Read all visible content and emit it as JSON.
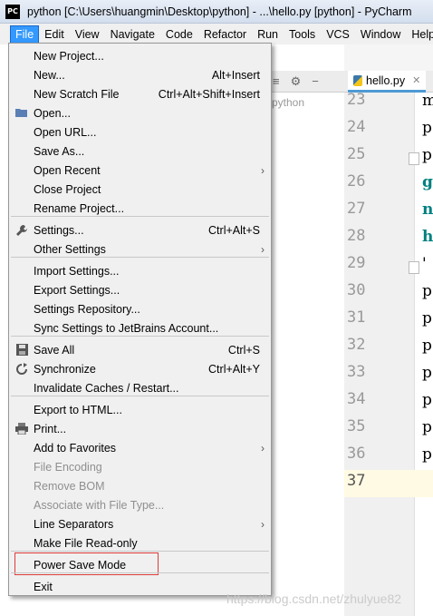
{
  "window": {
    "app_icon": "PC",
    "title": "python [C:\\Users\\huangmin\\Desktop\\python] - ...\\hello.py [python] - PyCharm"
  },
  "menubar": {
    "items": [
      "File",
      "Edit",
      "View",
      "Navigate",
      "Code",
      "Refactor",
      "Run",
      "Tools",
      "VCS",
      "Window",
      "Help"
    ]
  },
  "project_pane": {
    "label": "python",
    "toolbar_icons": [
      "collapse-icon",
      "gear-icon",
      "hide-icon"
    ]
  },
  "editor": {
    "tab_label": "hello.py",
    "line_numbers": [
      "23",
      "24",
      "25",
      "26",
      "27",
      "28",
      "29",
      "30",
      "31",
      "32",
      "33",
      "34",
      "35",
      "36",
      "37"
    ],
    "visible_code_chars": [
      "m",
      "p",
      "p",
      "g",
      "n",
      "h",
      "'",
      "p",
      "p",
      "p",
      "p",
      "p",
      "p",
      "p",
      ""
    ]
  },
  "file_menu": {
    "items": [
      {
        "label": "New Project...",
        "shortcut": "",
        "icon": "",
        "submenu": false,
        "disabled": false
      },
      {
        "label": "New...",
        "shortcut": "Alt+Insert",
        "icon": "",
        "submenu": false,
        "disabled": false
      },
      {
        "label": "New Scratch File",
        "shortcut": "Ctrl+Alt+Shift+Insert",
        "icon": "",
        "submenu": false,
        "disabled": false
      },
      {
        "label": "Open...",
        "shortcut": "",
        "icon": "folder-icon",
        "submenu": false,
        "disabled": false
      },
      {
        "label": "Open URL...",
        "shortcut": "",
        "icon": "",
        "submenu": false,
        "disabled": false
      },
      {
        "label": "Save As...",
        "shortcut": "",
        "icon": "",
        "submenu": false,
        "disabled": false
      },
      {
        "label": "Open Recent",
        "shortcut": "",
        "icon": "",
        "submenu": true,
        "disabled": false
      },
      {
        "label": "Close Project",
        "shortcut": "",
        "icon": "",
        "submenu": false,
        "disabled": false
      },
      {
        "label": "Rename Project...",
        "shortcut": "",
        "icon": "",
        "submenu": false,
        "disabled": false
      },
      {
        "label": "Settings...",
        "shortcut": "Ctrl+Alt+S",
        "icon": "wrench-icon",
        "submenu": false,
        "disabled": false
      },
      {
        "label": "Other Settings",
        "shortcut": "",
        "icon": "",
        "submenu": true,
        "disabled": false
      },
      {
        "label": "Import Settings...",
        "shortcut": "",
        "icon": "",
        "submenu": false,
        "disabled": false
      },
      {
        "label": "Export Settings...",
        "shortcut": "",
        "icon": "",
        "submenu": false,
        "disabled": false
      },
      {
        "label": "Settings Repository...",
        "shortcut": "",
        "icon": "",
        "submenu": false,
        "disabled": false
      },
      {
        "label": "Sync Settings to JetBrains Account...",
        "shortcut": "",
        "icon": "",
        "submenu": false,
        "disabled": false
      },
      {
        "label": "Save All",
        "shortcut": "Ctrl+S",
        "icon": "save-icon",
        "submenu": false,
        "disabled": false
      },
      {
        "label": "Synchronize",
        "shortcut": "Ctrl+Alt+Y",
        "icon": "sync-icon",
        "submenu": false,
        "disabled": false
      },
      {
        "label": "Invalidate Caches / Restart...",
        "shortcut": "",
        "icon": "",
        "submenu": false,
        "disabled": false
      },
      {
        "label": "Export to HTML...",
        "shortcut": "",
        "icon": "",
        "submenu": false,
        "disabled": false
      },
      {
        "label": "Print...",
        "shortcut": "",
        "icon": "printer-icon",
        "submenu": false,
        "disabled": false
      },
      {
        "label": "Add to Favorites",
        "shortcut": "",
        "icon": "",
        "submenu": true,
        "disabled": false
      },
      {
        "label": "File Encoding",
        "shortcut": "",
        "icon": "",
        "submenu": false,
        "disabled": true
      },
      {
        "label": "Remove BOM",
        "shortcut": "",
        "icon": "",
        "submenu": false,
        "disabled": true
      },
      {
        "label": "Associate with File Type...",
        "shortcut": "",
        "icon": "",
        "submenu": false,
        "disabled": true
      },
      {
        "label": "Line Separators",
        "shortcut": "",
        "icon": "",
        "submenu": true,
        "disabled": false
      },
      {
        "label": "Make File Read-only",
        "shortcut": "",
        "icon": "",
        "submenu": false,
        "disabled": false
      },
      {
        "label": "Power Save Mode",
        "shortcut": "",
        "icon": "",
        "submenu": false,
        "disabled": false
      },
      {
        "label": "Exit",
        "shortcut": "",
        "icon": "",
        "submenu": false,
        "disabled": false
      }
    ]
  },
  "watermark": "https://blog.csdn.net/zhulyue82"
}
